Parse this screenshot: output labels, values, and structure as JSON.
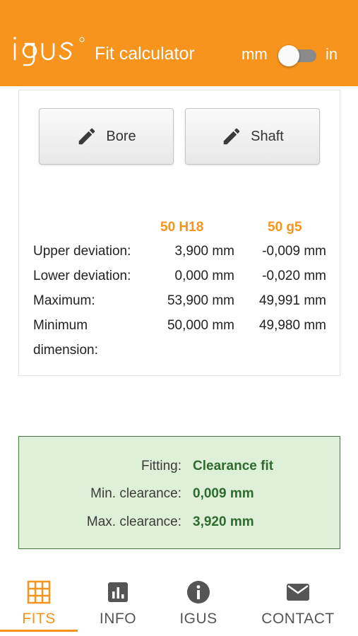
{
  "header": {
    "logo_text": "igus",
    "title": "Fit calculator",
    "unit_left": "mm",
    "unit_right": "in",
    "unit_toggle_state": "mm",
    "background_color": "#f7941d"
  },
  "buttons": {
    "bore_label": "Bore",
    "shaft_label": "Shaft"
  },
  "table": {
    "columns": [
      "50 H18",
      "50 g5"
    ],
    "rows": [
      {
        "label": "Upper deviation:",
        "bore": "3,900 mm",
        "shaft": "-0,009 mm"
      },
      {
        "label": "Lower deviation:",
        "bore": "0,000 mm",
        "shaft": "-0,020 mm"
      },
      {
        "label": "Maximum:",
        "bore": "53,900 mm",
        "shaft": "49,991 mm"
      },
      {
        "label_line1": "Minimum",
        "label_line2": "dimension:",
        "bore": "50,000 mm",
        "shaft": "49,980 mm"
      }
    ]
  },
  "result": {
    "fitting_label": "Fitting:",
    "fitting_value": "Clearance fit",
    "min_label": "Min. clearance:",
    "min_value": "0,009 mm",
    "max_label": "Max. clearance:",
    "max_value": "3,920 mm"
  },
  "tabs": [
    {
      "label": "FITS",
      "icon": "grid-icon",
      "active": true
    },
    {
      "label": "INFO",
      "icon": "bar-chart-icon",
      "active": false
    },
    {
      "label": "IGUS",
      "icon": "info-circle-icon",
      "active": false
    },
    {
      "label": "CONTACT",
      "icon": "envelope-icon",
      "active": false
    }
  ],
  "colors": {
    "accent": "#f7941d",
    "result_bg": "#dff0d8",
    "result_text": "#2f6b2f"
  }
}
